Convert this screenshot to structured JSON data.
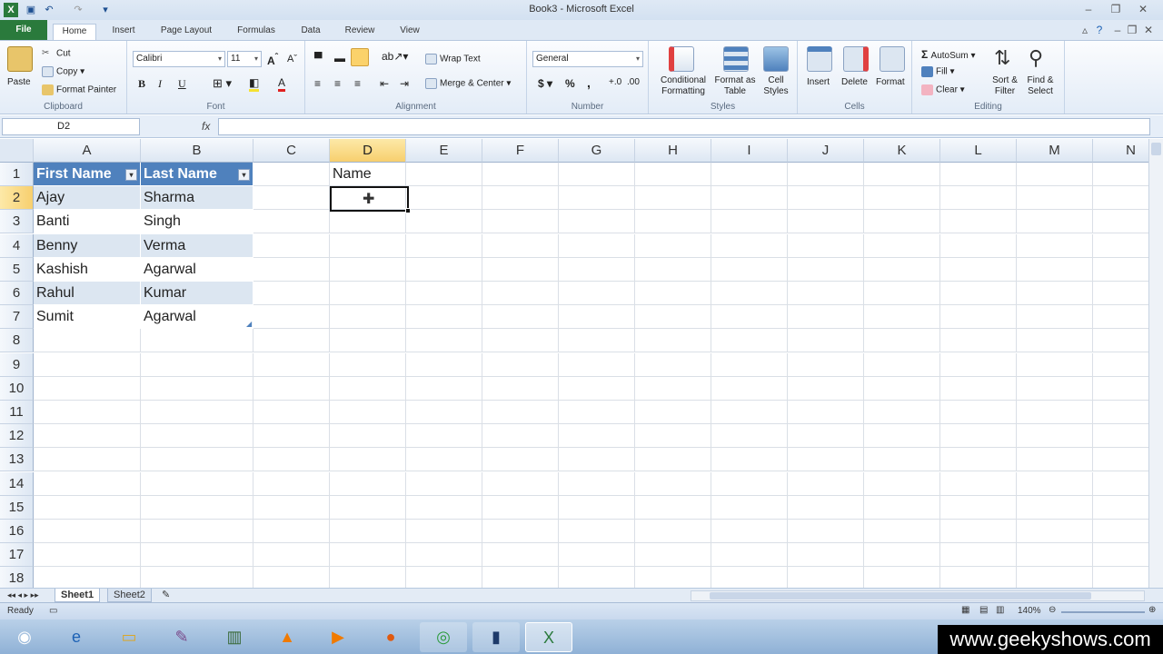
{
  "window": {
    "title": "Book3 - Microsoft Excel"
  },
  "tabs": [
    "File",
    "Home",
    "Insert",
    "Page Layout",
    "Formulas",
    "Data",
    "Review",
    "View"
  ],
  "ribbon": {
    "clipboard": {
      "label": "Clipboard",
      "paste": "Paste",
      "cut": "Cut",
      "copy": "Copy",
      "format_painter": "Format Painter"
    },
    "font": {
      "label": "Font",
      "font_name": "Calibri",
      "font_size": "11",
      "bold": "B",
      "italic": "I",
      "underline": "U"
    },
    "alignment": {
      "label": "Alignment",
      "wrap_text": "Wrap Text",
      "merge_center": "Merge & Center"
    },
    "number": {
      "label": "Number",
      "format": "General",
      "currency": "$",
      "percent": "%",
      "comma": ","
    },
    "styles": {
      "label": "Styles",
      "conditional_formatting": "Conditional Formatting",
      "format_as_table": "Format as Table",
      "cell_styles": "Cell Styles"
    },
    "cells": {
      "label": "Cells",
      "insert": "Insert",
      "delete": "Delete",
      "format": "Format"
    },
    "editing": {
      "label": "Editing",
      "autosum": "AutoSum",
      "fill": "Fill",
      "clear": "Clear",
      "sort_filter": "Sort & Filter",
      "find_select": "Find & Select"
    }
  },
  "formula_bar": {
    "name_box": "D2",
    "fx": "fx",
    "value": ""
  },
  "columns": [
    "A",
    "B",
    "C",
    "D",
    "E",
    "F",
    "G",
    "H",
    "I",
    "J",
    "K",
    "L",
    "M",
    "N"
  ],
  "rows": [
    "1",
    "2",
    "3",
    "4",
    "5",
    "6",
    "7",
    "8",
    "9",
    "10",
    "11",
    "12",
    "13",
    "14",
    "15",
    "16",
    "17",
    "18"
  ],
  "table": {
    "headers": [
      "First Name",
      "Last Name"
    ],
    "rows": [
      [
        "Ajay",
        "Sharma"
      ],
      [
        "Banti",
        "Singh"
      ],
      [
        "Benny",
        "Verma"
      ],
      [
        "Kashish",
        "Agarwal"
      ],
      [
        "Rahul",
        "Kumar"
      ],
      [
        "Sumit",
        "Agarwal"
      ]
    ]
  },
  "cells": {
    "D1": "Name"
  },
  "sheets": [
    "Sheet1",
    "Sheet2"
  ],
  "status": {
    "mode": "Ready",
    "zoom": "140%"
  },
  "watermark": "www.geekyshows.com",
  "colors": {
    "table_header": "#4f81bd",
    "table_band": "#dce6f1",
    "file_tab": "#2a7a3c",
    "selected_header": "#f7cf6e"
  }
}
